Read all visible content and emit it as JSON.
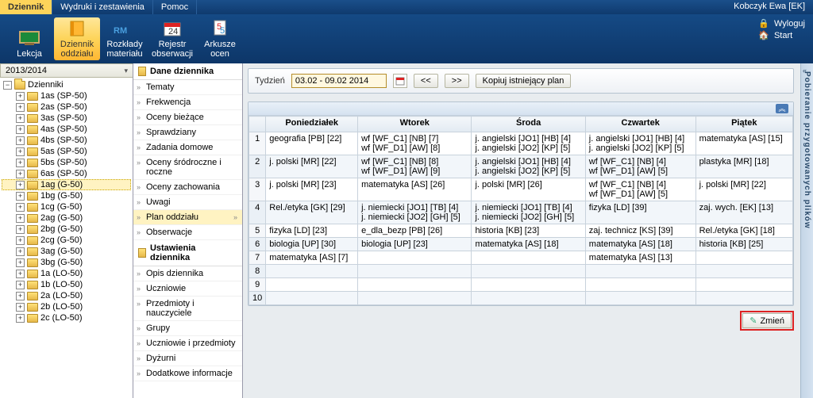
{
  "menubar": {
    "tabs": [
      "Dziennik",
      "Wydruki i zestawienia",
      "Pomoc"
    ],
    "user": "Kobczyk Ewa [EK]"
  },
  "ribbon": {
    "items": [
      {
        "label": "Lekcja"
      },
      {
        "label": "Dziennik oddziału"
      },
      {
        "label": "Rozkłady materiału"
      },
      {
        "label": "Rejestr obserwacji"
      },
      {
        "label": "Arkusze ocen"
      }
    ],
    "logout": "Wyloguj",
    "start": "Start"
  },
  "year": "2013/2014",
  "tree": {
    "root": "Dzienniki",
    "items": [
      "1as (SP-50)",
      "2as (SP-50)",
      "3as (SP-50)",
      "4as (SP-50)",
      "4bs (SP-50)",
      "5as (SP-50)",
      "5bs (SP-50)",
      "6as (SP-50)",
      "1ag (G-50)",
      "1bg (G-50)",
      "1cg (G-50)",
      "2ag (G-50)",
      "2bg (G-50)",
      "2cg (G-50)",
      "3ag (G-50)",
      "3bg (G-50)",
      "1a (LO-50)",
      "1b (LO-50)",
      "2a (LO-50)",
      "2b (LO-50)",
      "2c (LO-50)"
    ],
    "active": "1ag (G-50)"
  },
  "midnav": {
    "header1": "Dane dziennika",
    "group1": [
      "Tematy",
      "Frekwencja",
      "Oceny bieżące",
      "Sprawdziany",
      "Zadania domowe",
      "Oceny śródroczne i roczne",
      "Oceny zachowania",
      "Uwagi",
      "Plan oddziału",
      "Obserwacje"
    ],
    "active": "Plan oddziału",
    "header2": "Ustawienia dziennika",
    "group2": [
      "Opis dziennika",
      "Uczniowie",
      "Przedmioty i nauczyciele",
      "Grupy",
      "Uczniowie i przedmioty",
      "Dyżurni",
      "Dodatkowe informacje"
    ]
  },
  "toolbar": {
    "week_label": "Tydzień",
    "date_value": "03.02 - 09.02 2014",
    "prev": "<<",
    "next": ">>",
    "copy": "Kopiuj istniejący plan"
  },
  "table": {
    "headers": [
      "",
      "Poniedziałek",
      "Wtorek",
      "Środa",
      "Czwartek",
      "Piątek"
    ],
    "rows": [
      {
        "n": "1",
        "cells": [
          "geografia [PB] [22]",
          "wf [WF_C1] [NB] [7]\nwf [WF_D1] [AW] [8]",
          "j. angielski [JO1] [HB] [4]\nj. angielski [JO2] [KP] [5]",
          "j. angielski [JO1] [HB] [4]\nj. angielski [JO2] [KP] [5]",
          "matematyka [AS] [15]"
        ]
      },
      {
        "n": "2",
        "cells": [
          "j. polski [MR] [22]",
          "wf [WF_C1] [NB] [8]\nwf [WF_D1] [AW] [9]",
          "j. angielski [JO1] [HB] [4]\nj. angielski [JO2] [KP] [5]",
          "wf [WF_C1] [NB] [4]\nwf [WF_D1] [AW] [5]",
          "plastyka [MR] [18]"
        ]
      },
      {
        "n": "3",
        "cells": [
          "j. polski [MR] [23]",
          "matematyka [AS] [26]",
          "j. polski [MR] [26]",
          "wf [WF_C1] [NB] [4]\nwf [WF_D1] [AW] [5]",
          "j. polski [MR] [22]"
        ]
      },
      {
        "n": "4",
        "cells": [
          "Rel./etyka [GK] [29]",
          "j. niemiecki [JO1] [TB] [4]\nj. niemiecki [JO2] [GH] [5]",
          "j. niemiecki [JO1] [TB] [4]\nj. niemiecki [JO2] [GH] [5]",
          "fizyka [LD] [39]",
          "zaj. wych. [EK] [13]"
        ]
      },
      {
        "n": "5",
        "cells": [
          "fizyka [LD] [23]",
          "e_dla_bezp [PB] [26]",
          "historia [KB] [23]",
          "zaj. technicz [KS] [39]",
          "Rel./etyka [GK] [18]"
        ]
      },
      {
        "n": "6",
        "cells": [
          "biologia [UP] [30]",
          "biologia [UP] [23]",
          "matematyka [AS] [18]",
          "matematyka [AS] [18]",
          "historia [KB] [25]"
        ]
      },
      {
        "n": "7",
        "cells": [
          "matematyka [AS] [7]",
          "",
          "",
          "matematyka [AS] [13]",
          ""
        ]
      },
      {
        "n": "8",
        "cells": [
          "",
          "",
          "",
          "",
          ""
        ]
      },
      {
        "n": "9",
        "cells": [
          "",
          "",
          "",
          "",
          ""
        ]
      },
      {
        "n": "10",
        "cells": [
          "",
          "",
          "",
          "",
          ""
        ]
      }
    ]
  },
  "footer": {
    "change": "Zmień"
  },
  "sidetab": "Pobieranie przygotowanych plików"
}
